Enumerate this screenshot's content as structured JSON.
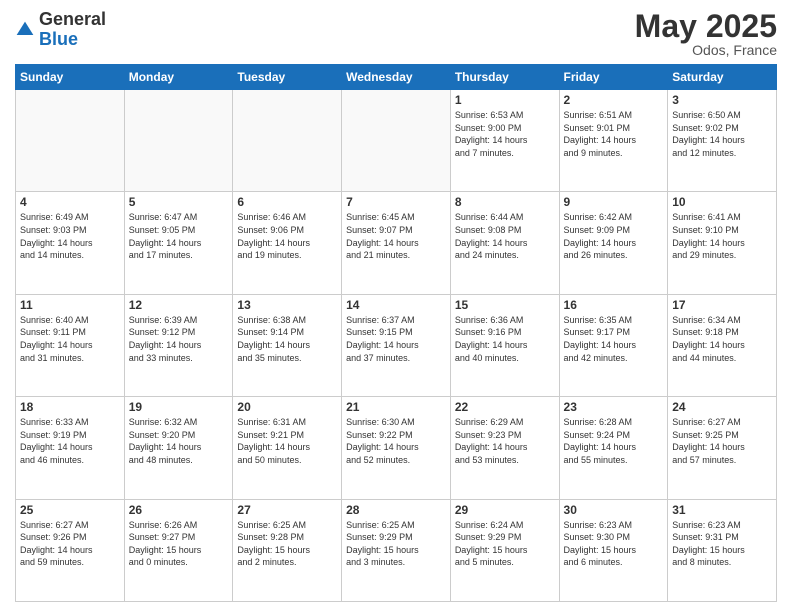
{
  "header": {
    "logo_general": "General",
    "logo_blue": "Blue",
    "month_title": "May 2025",
    "location": "Odos, France"
  },
  "days_of_week": [
    "Sunday",
    "Monday",
    "Tuesday",
    "Wednesday",
    "Thursday",
    "Friday",
    "Saturday"
  ],
  "weeks": [
    [
      {
        "num": "",
        "info": ""
      },
      {
        "num": "",
        "info": ""
      },
      {
        "num": "",
        "info": ""
      },
      {
        "num": "",
        "info": ""
      },
      {
        "num": "1",
        "info": "Sunrise: 6:53 AM\nSunset: 9:00 PM\nDaylight: 14 hours\nand 7 minutes."
      },
      {
        "num": "2",
        "info": "Sunrise: 6:51 AM\nSunset: 9:01 PM\nDaylight: 14 hours\nand 9 minutes."
      },
      {
        "num": "3",
        "info": "Sunrise: 6:50 AM\nSunset: 9:02 PM\nDaylight: 14 hours\nand 12 minutes."
      }
    ],
    [
      {
        "num": "4",
        "info": "Sunrise: 6:49 AM\nSunset: 9:03 PM\nDaylight: 14 hours\nand 14 minutes."
      },
      {
        "num": "5",
        "info": "Sunrise: 6:47 AM\nSunset: 9:05 PM\nDaylight: 14 hours\nand 17 minutes."
      },
      {
        "num": "6",
        "info": "Sunrise: 6:46 AM\nSunset: 9:06 PM\nDaylight: 14 hours\nand 19 minutes."
      },
      {
        "num": "7",
        "info": "Sunrise: 6:45 AM\nSunset: 9:07 PM\nDaylight: 14 hours\nand 21 minutes."
      },
      {
        "num": "8",
        "info": "Sunrise: 6:44 AM\nSunset: 9:08 PM\nDaylight: 14 hours\nand 24 minutes."
      },
      {
        "num": "9",
        "info": "Sunrise: 6:42 AM\nSunset: 9:09 PM\nDaylight: 14 hours\nand 26 minutes."
      },
      {
        "num": "10",
        "info": "Sunrise: 6:41 AM\nSunset: 9:10 PM\nDaylight: 14 hours\nand 29 minutes."
      }
    ],
    [
      {
        "num": "11",
        "info": "Sunrise: 6:40 AM\nSunset: 9:11 PM\nDaylight: 14 hours\nand 31 minutes."
      },
      {
        "num": "12",
        "info": "Sunrise: 6:39 AM\nSunset: 9:12 PM\nDaylight: 14 hours\nand 33 minutes."
      },
      {
        "num": "13",
        "info": "Sunrise: 6:38 AM\nSunset: 9:14 PM\nDaylight: 14 hours\nand 35 minutes."
      },
      {
        "num": "14",
        "info": "Sunrise: 6:37 AM\nSunset: 9:15 PM\nDaylight: 14 hours\nand 37 minutes."
      },
      {
        "num": "15",
        "info": "Sunrise: 6:36 AM\nSunset: 9:16 PM\nDaylight: 14 hours\nand 40 minutes."
      },
      {
        "num": "16",
        "info": "Sunrise: 6:35 AM\nSunset: 9:17 PM\nDaylight: 14 hours\nand 42 minutes."
      },
      {
        "num": "17",
        "info": "Sunrise: 6:34 AM\nSunset: 9:18 PM\nDaylight: 14 hours\nand 44 minutes."
      }
    ],
    [
      {
        "num": "18",
        "info": "Sunrise: 6:33 AM\nSunset: 9:19 PM\nDaylight: 14 hours\nand 46 minutes."
      },
      {
        "num": "19",
        "info": "Sunrise: 6:32 AM\nSunset: 9:20 PM\nDaylight: 14 hours\nand 48 minutes."
      },
      {
        "num": "20",
        "info": "Sunrise: 6:31 AM\nSunset: 9:21 PM\nDaylight: 14 hours\nand 50 minutes."
      },
      {
        "num": "21",
        "info": "Sunrise: 6:30 AM\nSunset: 9:22 PM\nDaylight: 14 hours\nand 52 minutes."
      },
      {
        "num": "22",
        "info": "Sunrise: 6:29 AM\nSunset: 9:23 PM\nDaylight: 14 hours\nand 53 minutes."
      },
      {
        "num": "23",
        "info": "Sunrise: 6:28 AM\nSunset: 9:24 PM\nDaylight: 14 hours\nand 55 minutes."
      },
      {
        "num": "24",
        "info": "Sunrise: 6:27 AM\nSunset: 9:25 PM\nDaylight: 14 hours\nand 57 minutes."
      }
    ],
    [
      {
        "num": "25",
        "info": "Sunrise: 6:27 AM\nSunset: 9:26 PM\nDaylight: 14 hours\nand 59 minutes."
      },
      {
        "num": "26",
        "info": "Sunrise: 6:26 AM\nSunset: 9:27 PM\nDaylight: 15 hours\nand 0 minutes."
      },
      {
        "num": "27",
        "info": "Sunrise: 6:25 AM\nSunset: 9:28 PM\nDaylight: 15 hours\nand 2 minutes."
      },
      {
        "num": "28",
        "info": "Sunrise: 6:25 AM\nSunset: 9:29 PM\nDaylight: 15 hours\nand 3 minutes."
      },
      {
        "num": "29",
        "info": "Sunrise: 6:24 AM\nSunset: 9:29 PM\nDaylight: 15 hours\nand 5 minutes."
      },
      {
        "num": "30",
        "info": "Sunrise: 6:23 AM\nSunset: 9:30 PM\nDaylight: 15 hours\nand 6 minutes."
      },
      {
        "num": "31",
        "info": "Sunrise: 6:23 AM\nSunset: 9:31 PM\nDaylight: 15 hours\nand 8 minutes."
      }
    ]
  ]
}
